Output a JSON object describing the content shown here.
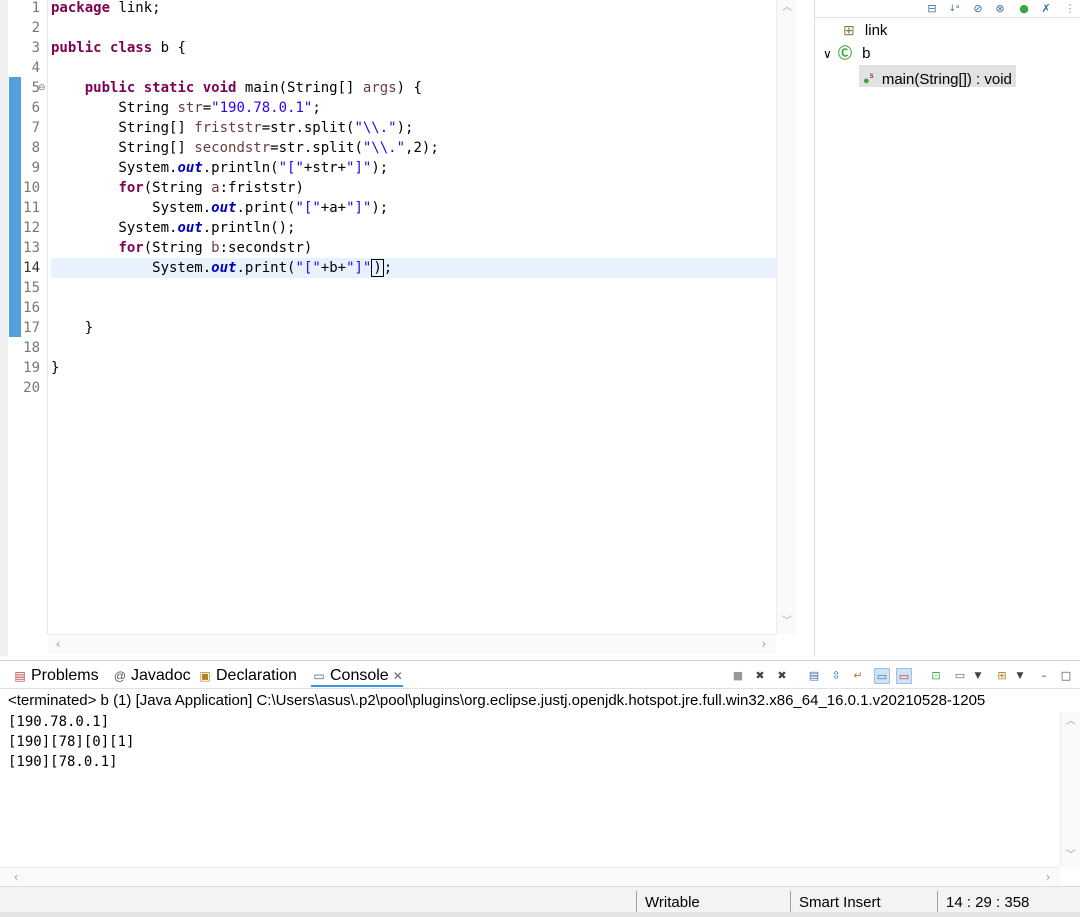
{
  "editor": {
    "line_numbers": [
      "1",
      "2",
      "3",
      "4",
      "5",
      "6",
      "7",
      "8",
      "9",
      "10",
      "11",
      "12",
      "13",
      "14",
      "15",
      "16",
      "17",
      "18",
      "19",
      "20"
    ],
    "code": {
      "l1_kw": "package",
      "l1_rest": " link;",
      "l3_kw1": "public",
      "l3_kw2": "class",
      "l3_rest": " b {",
      "l5_indent": "    ",
      "l5_kw1": "public",
      "l5_kw2": "static",
      "l5_kw3": "void",
      "l5_rest1": " main(String[] ",
      "l5_var": "args",
      "l5_rest2": ") {",
      "l6_pre": "        String ",
      "l6_var": "str",
      "l6_eq": "=",
      "l6_str": "\"190.78.0.1\"",
      "l6_end": ";",
      "l7_pre": "        String[] ",
      "l7_var": "friststr",
      "l7_mid": "=str.split(",
      "l7_str": "\"\\\\.\"",
      "l7_end": ");",
      "l8_pre": "        String[] ",
      "l8_var": "secondstr",
      "l8_mid": "=str.split(",
      "l8_str": "\"\\\\.\"",
      "l8_end": ",2);",
      "l9_pre": "        System.",
      "l9_fld": "out",
      "l9_mid": ".println(",
      "l9_s1": "\"[\"",
      "l9_mid2": "+str+",
      "l9_s2": "\"]\"",
      "l9_end": ");",
      "l10_pre": "        ",
      "l10_kw": "for",
      "l10_mid": "(String ",
      "l10_var": "a",
      "l10_end": ":friststr)",
      "l11_pre": "            System.",
      "l11_fld": "out",
      "l11_mid": ".print(",
      "l11_s1": "\"[\"",
      "l11_mid2": "+a+",
      "l11_s2": "\"]\"",
      "l11_end": ");",
      "l12_pre": "        System.",
      "l12_fld": "out",
      "l12_end": ".println();",
      "l13_pre": "        ",
      "l13_kw": "for",
      "l13_mid": "(String ",
      "l13_var": "b",
      "l13_end": ":secondstr)",
      "l14_pre": "            System.",
      "l14_fld": "out",
      "l14_mid": ".print(",
      "l14_s1": "\"[\"",
      "l14_mid2": "+b+",
      "l14_s2": "\"]\"",
      "l14_caret": ")",
      "l14_end": ";",
      "l17": "    }",
      "l19": "}"
    }
  },
  "outline": {
    "package_label": "link",
    "class_label": "b",
    "method_label": "main(String[]) : void"
  },
  "console": {
    "tabs": {
      "problems": "Problems",
      "javadoc": "Javadoc",
      "declaration": "Declaration",
      "console": "Console"
    },
    "status_line": "<terminated> b (1) [Java Application] C:\\Users\\asus\\.p2\\pool\\plugins\\org.eclipse.justj.openjdk.hotspot.jre.full.win32.x86_64_16.0.1.v20210528-1205",
    "output": [
      "[190.78.0.1]",
      "[190][78][0][1]",
      "[190][78.0.1]"
    ]
  },
  "statusbar": {
    "writable": "Writable",
    "insert_mode": "Smart Insert",
    "position": "14 : 29 : 358"
  },
  "icons": {
    "package": "package-icon",
    "class": "class-icon",
    "method": "public-method-icon"
  },
  "colors": {
    "keyword": "#7f0055",
    "string": "#2a00ff",
    "field": "#0000c0",
    "current_line": "#e8f2fe",
    "change_bar": "#3f96d8"
  }
}
